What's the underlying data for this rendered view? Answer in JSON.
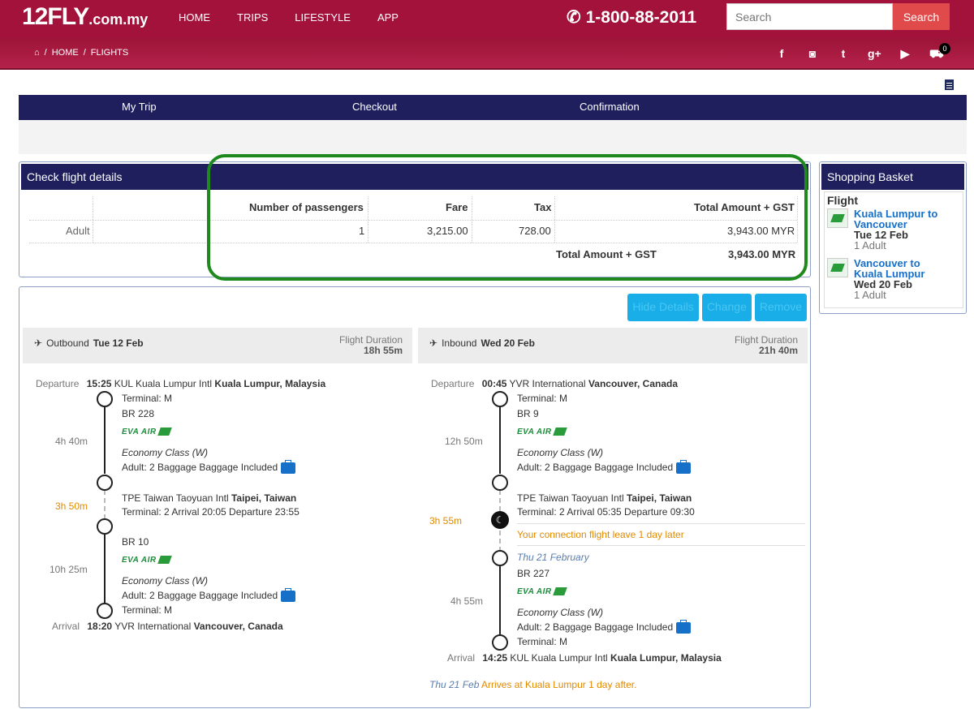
{
  "header": {
    "logo_main": "12FLY",
    "logo_suffix": ".com.my",
    "nav": [
      "HOME",
      "TRIPS",
      "LIFESTYLE",
      "APP"
    ],
    "phone": "1-800-88-2011",
    "search_placeholder": "Search",
    "search_button": "Search"
  },
  "breadcrumb": [
    "HOME",
    "FLIGHTS"
  ],
  "cart_count": "0",
  "steps": [
    "My Trip",
    "Checkout",
    "Confirmation"
  ],
  "flight_details": {
    "title": "Check flight details",
    "headers": [
      "Number of passengers",
      "Fare",
      "Tax",
      "Total Amount + GST"
    ],
    "row": {
      "type": "Adult",
      "passengers": "1",
      "fare": "3,215.00",
      "tax": "728.00",
      "total": "3,943.00 MYR"
    },
    "total_label": "Total Amount + GST",
    "total_value": "3,943.00 MYR"
  },
  "basket": {
    "title": "Shopping Basket",
    "section": "Flight",
    "items": [
      {
        "route_line1": "Kuala Lumpur to",
        "route_line2": "Vancouver",
        "date": "Tue 12 Feb",
        "pax": "1 Adult"
      },
      {
        "route_line1": "Vancouver to",
        "route_line2": "Kuala Lumpur",
        "date": "Wed 20 Feb",
        "pax": "1 Adult"
      }
    ]
  },
  "actions": [
    "Hide Details",
    "Change",
    "Remove"
  ],
  "outbound": {
    "label": "Outbound",
    "date": "Tue 12 Feb",
    "duration_label": "Flight Duration",
    "duration": "18h 55m",
    "departure_label": "Departure",
    "departure_time": "15:25",
    "departure_airport": "KUL Kuala Lumpur Intl",
    "departure_city": "Kuala Lumpur, Malaysia",
    "terminal1": "Terminal: M",
    "flight1": "BR 228",
    "seg1_duration": "4h 40m",
    "class1": "Economy Class (W)",
    "baggage1": "Adult: 2 Baggage Baggage Included",
    "layover": "3h 50m",
    "transit_airport": "TPE Taiwan Taoyuan Intl",
    "transit_city": "Taipei, Taiwan",
    "transit_info": "Terminal: 2  Arrival 20:05 Departure 23:55",
    "flight2": "BR 10",
    "seg2_duration": "10h 25m",
    "class2": "Economy Class (W)",
    "baggage2": "Adult: 2 Baggage Baggage Included",
    "terminal2": "Terminal: M",
    "arrival_label": "Arrival",
    "arrival_time": "18:20",
    "arrival_airport": "YVR International",
    "arrival_city": "Vancouver, Canada"
  },
  "inbound": {
    "label": "Inbound",
    "date": "Wed 20 Feb",
    "duration_label": "Flight Duration",
    "duration": "21h 40m",
    "departure_label": "Departure",
    "departure_time": "00:45",
    "departure_airport": "YVR International",
    "departure_city": "Vancouver, Canada",
    "terminal1": "Terminal: M",
    "flight1": "BR 9",
    "seg1_duration": "12h 50m",
    "class1": "Economy Class (W)",
    "baggage1": "Adult: 2 Baggage Baggage Included",
    "layover": "3h 55m",
    "transit_airport": "TPE Taiwan Taoyuan Intl",
    "transit_city": "Taipei, Taiwan",
    "transit_info": "Terminal: 2  Arrival 05:35 Departure 09:30",
    "next_day_notice": "Your connection flight leave 1 day later",
    "next_date": "Thu 21 February",
    "flight2": "BR 227",
    "seg2_duration": "4h 55m",
    "class2": "Economy Class (W)",
    "baggage2": "Adult: 2 Baggage Baggage Included",
    "terminal2": "Terminal: M",
    "arrival_label": "Arrival",
    "arrival_time": "14:25",
    "arrival_airport": "KUL Kuala Lumpur Intl",
    "arrival_city": "Kuala Lumpur, Malaysia",
    "arrival_note_date": "Thu 21 Feb",
    "arrival_note": "Arrives at Kuala Lumpur 1 day after."
  },
  "airline_name": "EVA AIR"
}
